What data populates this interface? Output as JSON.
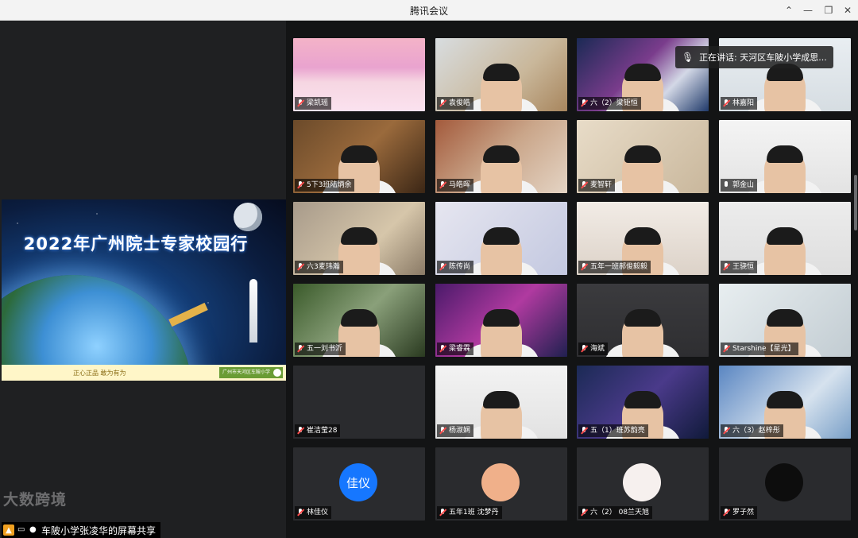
{
  "window": {
    "title": "腾讯会议"
  },
  "share": {
    "slide_title": "2022年广州院士专家校园行",
    "slide_footer_left": "正心正品  敢为有为",
    "slide_footer_right": "广州市天河区车陂小学",
    "presenter_label": "车陂小学张凌华的屏幕共享",
    "watermark": "大数跨境"
  },
  "speaking_indicator": "正在讲话: 天河区车陂小学成思...",
  "participants": [
    {
      "name": "梁凯瑶",
      "muted": true
    },
    {
      "name": "袁俊皓",
      "muted": true
    },
    {
      "name": "六（2）梁钜恒",
      "muted": true
    },
    {
      "name": "林嘉阳",
      "muted": true
    },
    {
      "name": "5下3班陆炳余",
      "muted": true
    },
    {
      "name": "马皓晖",
      "muted": true
    },
    {
      "name": "麦智轩",
      "muted": true
    },
    {
      "name": "郭金山",
      "muted": false
    },
    {
      "name": "六3麦玮瀚",
      "muted": true
    },
    {
      "name": "陈传尚",
      "muted": true
    },
    {
      "name": "五年一班郝俊毅毅",
      "muted": true
    },
    {
      "name": "王骁恒",
      "muted": true
    },
    {
      "name": "五一刘书沂",
      "muted": true
    },
    {
      "name": "梁睿霖",
      "muted": true
    },
    {
      "name": "海斌",
      "muted": true
    },
    {
      "name": "Starshine【星光】",
      "muted": true
    },
    {
      "name": "崔洁莹28",
      "muted": true
    },
    {
      "name": "杨淑娴",
      "muted": true
    },
    {
      "name": "五（1）班苏韵亮",
      "muted": true
    },
    {
      "name": "六（3）赵梓彤",
      "muted": true
    },
    {
      "name": "林佳仪",
      "muted": true,
      "avatar_text": "佳仪",
      "avatar_color": "#1677ff"
    },
    {
      "name": "五年1班 沈梦丹",
      "muted": true
    },
    {
      "name": "六（2） 08兰天旭",
      "muted": true
    },
    {
      "name": "罗子然",
      "muted": true
    }
  ],
  "colors": {
    "titlebar": "#f3f3f3",
    "background": "#131415",
    "accent": "#1677ff"
  }
}
